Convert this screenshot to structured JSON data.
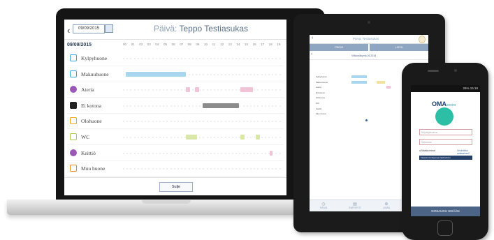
{
  "laptop": {
    "date_value": "09/09/2015",
    "title_label": "Päivä:",
    "title_name": "Teppo Testiasukas",
    "day_label": "09/09/2015",
    "hours": [
      "00",
      "01",
      "02",
      "03",
      "04",
      "05",
      "06",
      "07",
      "08",
      "09",
      "10",
      "11",
      "12",
      "13",
      "14",
      "15",
      "16",
      "17",
      "18",
      "19"
    ],
    "rooms": [
      {
        "label": "Kylpyhuone",
        "icon": "bath-icon",
        "color": "#3aa7d8"
      },
      {
        "label": "Makuuhuone",
        "icon": "bed-icon",
        "color": "#3aa7d8"
      },
      {
        "label": "Ateria",
        "icon": "meal-icon",
        "color": "#9b59b6"
      },
      {
        "label": "Ei kotona",
        "icon": "away-home-icon",
        "color": "#222222"
      },
      {
        "label": "Olohuone",
        "icon": "sofa-icon",
        "color": "#f2a51a"
      },
      {
        "label": "WC",
        "icon": "toilet-icon",
        "color": "#a8c84a"
      },
      {
        "label": "Keittiö",
        "icon": "kitchen-icon",
        "color": "#9b59b6"
      },
      {
        "label": "Muu huone",
        "icon": "door-icon",
        "color": "#e8891e"
      }
    ],
    "close_label": "Sulje"
  },
  "tablet": {
    "header_title": "Päivä: Testiasukas",
    "tabs": [
      "PÄIVÄ",
      "LISTA"
    ],
    "date_text": "Viikkonäkymä 26.2015",
    "rows": [
      "Kylpyhuone",
      "Makuuhuone",
      "Ateria",
      "Ei kotona",
      "Olohuone",
      "WC",
      "Keittiö",
      "Muu huone"
    ],
    "bottom": [
      "PÄIVÄ",
      "RAPORTIT",
      "LISÄÄ"
    ]
  },
  "phone": {
    "status": "26% 15:18",
    "logo": "OMA",
    "logo_sub": "senior",
    "username_placeholder": "Käyttäjätunnus",
    "password_placeholder": "Salasana",
    "remember": "Muista minut",
    "forgot": "Unohditko salasanasi?",
    "help_button": "Kirjautumisohjeet ja käyttöehdot",
    "login_button": "KIRJAUDU SISÄÄN"
  },
  "colors": {
    "screen_border": "#151515",
    "accent_blue": "#4c6587",
    "sleep_bar": "#a9d6ef",
    "away_bar": "#8c8c8c"
  }
}
